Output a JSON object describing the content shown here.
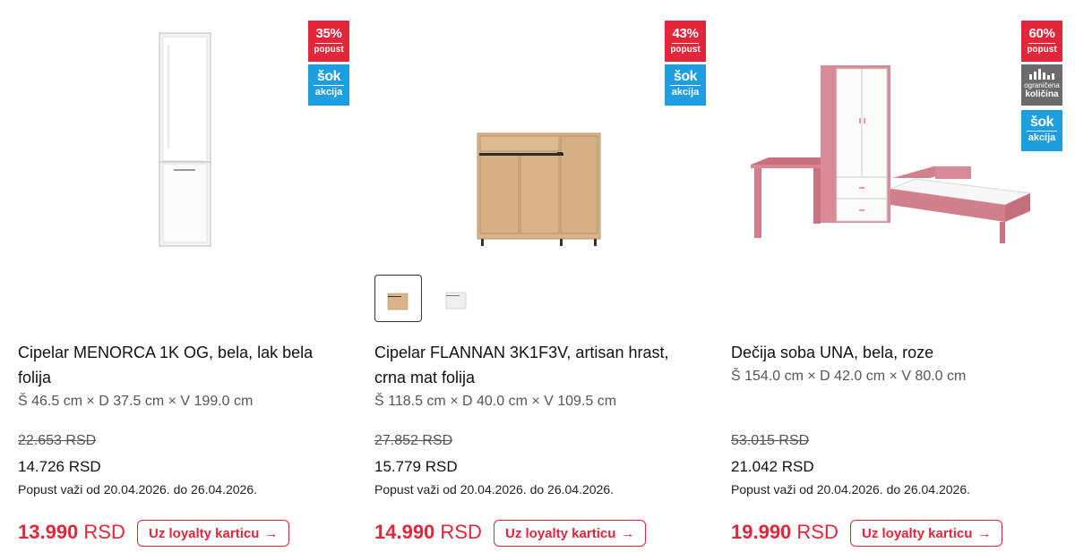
{
  "products": [
    {
      "title": "Cipelar MENORCA 1K OG, bela, lak bela folija",
      "dims": "Š 46.5 cm × D 37.5 cm × V 199.0 cm",
      "old_price": "22.653 RSD",
      "price": "14.726 RSD",
      "period": "Popust važi od 20.04.2026. do 26.04.2026.",
      "loyalty_price": "13.990",
      "loyalty_currency": "RSD",
      "loyalty_button": "Uz loyalty karticu",
      "discount": {
        "pct": "35%",
        "label": "popust"
      },
      "sok": {
        "line1": "šok",
        "line2": "akcija"
      }
    },
    {
      "title": "Cipelar FLANNAN 3K1F3V, artisan hrast, crna mat folija",
      "dims": "Š 118.5 cm × D 40.0 cm × V 109.5 cm",
      "old_price": "27.852 RSD",
      "price": "15.779 RSD",
      "period": "Popust važi od 20.04.2026. do 26.04.2026.",
      "loyalty_price": "14.990",
      "loyalty_currency": "RSD",
      "loyalty_button": "Uz loyalty karticu",
      "discount": {
        "pct": "43%",
        "label": "popust"
      },
      "sok": {
        "line1": "šok",
        "line2": "akcija"
      }
    },
    {
      "title": "Dečija soba UNA, bela, roze",
      "dims": "Š 154.0 cm × D 42.0 cm × V 80.0 cm",
      "old_price": "53.015 RSD",
      "price": "21.042 RSD",
      "period": "Popust važi od 20.04.2026. do 26.04.2026.",
      "loyalty_price": "19.990",
      "loyalty_currency": "RSD",
      "loyalty_button": "Uz loyalty karticu",
      "discount": {
        "pct": "60%",
        "label": "popust"
      },
      "limited": {
        "line1": "ograničena",
        "line2": "količina"
      },
      "sok": {
        "line1": "šok",
        "line2": "akcija"
      }
    }
  ],
  "icons": {
    "arrow": "→",
    "product_images": [
      "white-shoe-cabinet",
      "oak-shoe-cabinet",
      "kids-room-set"
    ]
  },
  "colors": {
    "accent_red": "#e3263a",
    "sok_blue": "#1e9ee0",
    "limited_gray": "#6b6b6b"
  }
}
